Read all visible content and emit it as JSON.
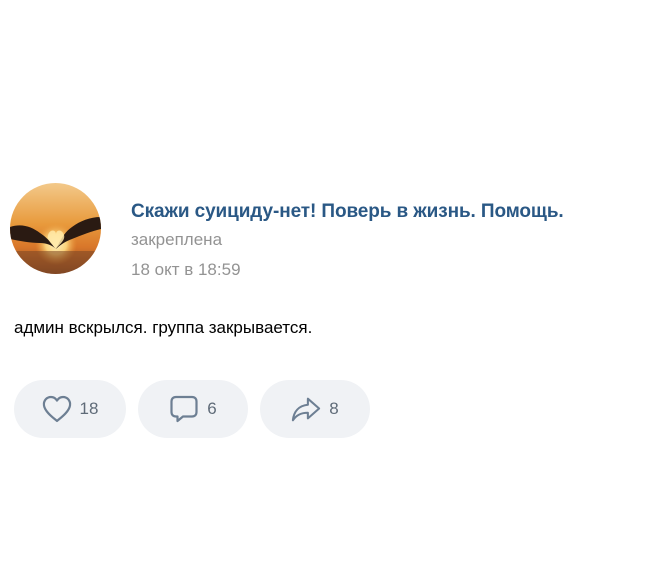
{
  "post": {
    "group_name": "Скажи суициду-нет! Поверь в жизнь. Помощь.",
    "pinned_label": "закреплена",
    "date": "18 окт в 18:59",
    "text": "админ вскрылся. группа закрывается."
  },
  "actions": {
    "likes": "18",
    "comments": "6",
    "shares": "8"
  },
  "icons": {
    "like": "heart-icon",
    "comment": "comment-icon",
    "share": "share-icon"
  },
  "colors": {
    "group_name": "#2a5885",
    "meta_text": "#939393",
    "action_bg": "#f0f2f5",
    "action_icon": "#6d7f93"
  }
}
